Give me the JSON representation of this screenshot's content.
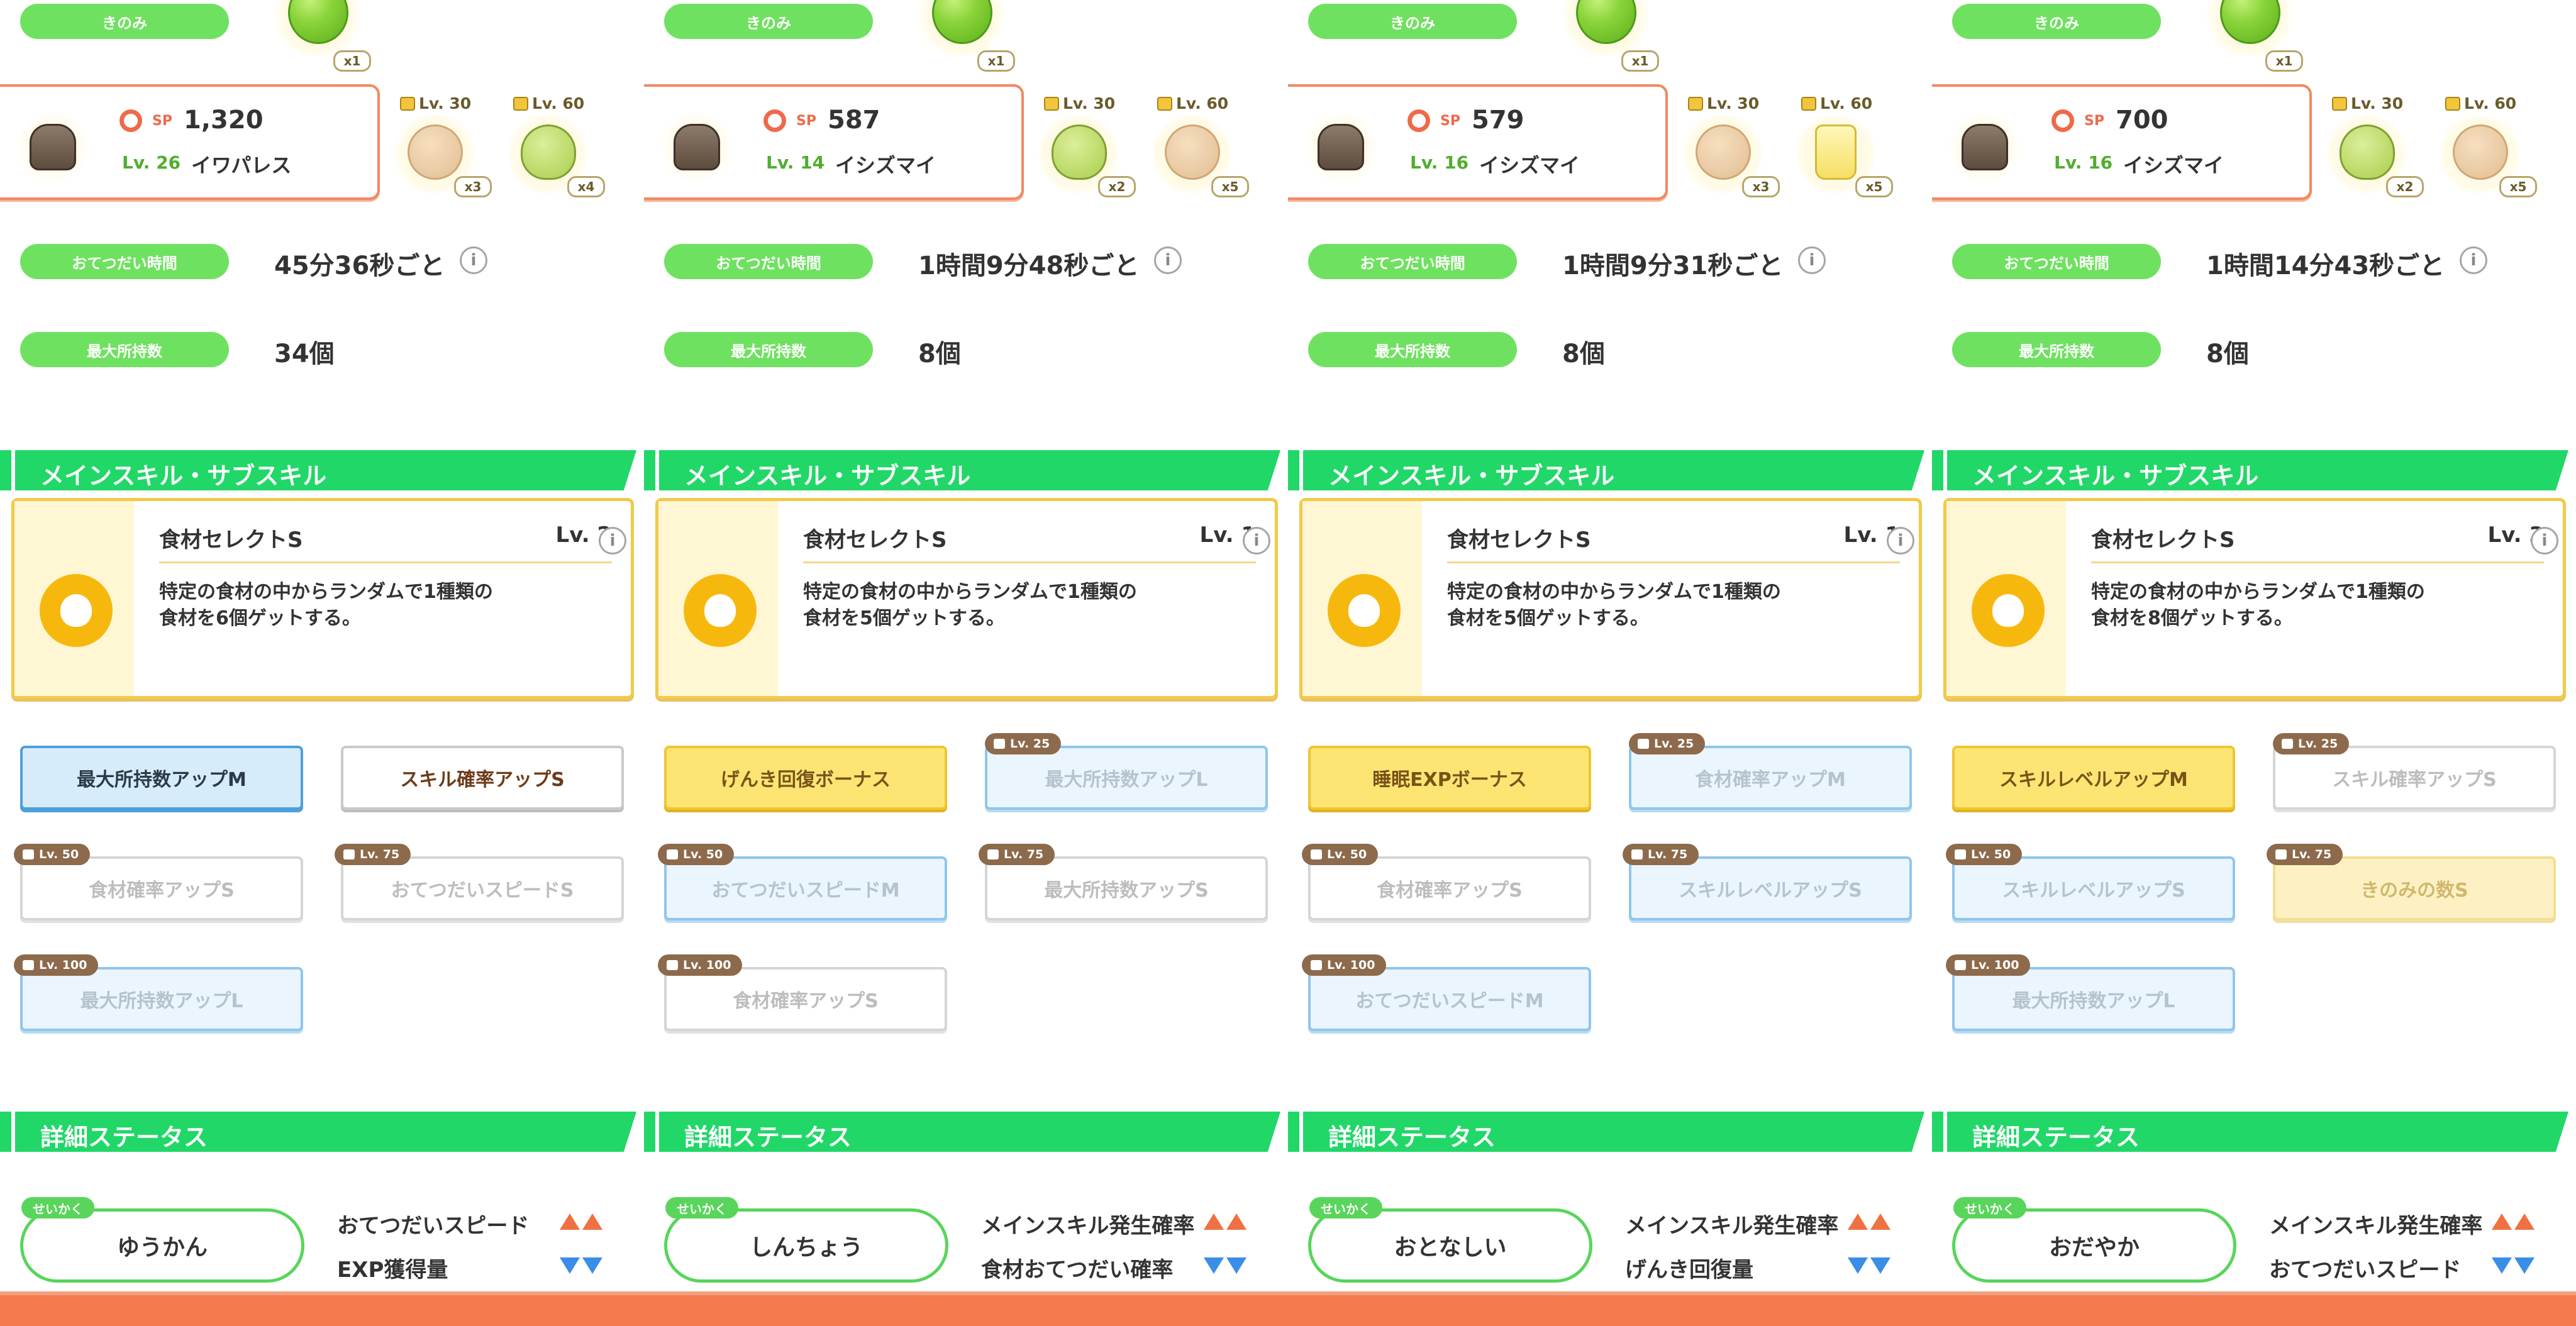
{
  "labels": {
    "berry_pill": "きのみ",
    "help_time_pill": "おてつだい時間",
    "max_inventory_pill": "最大所持数",
    "skills_section": "メインスキル・サブスキル",
    "detail_section": "詳細ステータス",
    "nature_tag": "せいかく",
    "sp_label": "SP",
    "info_glyph": "i",
    "berry_qty": "x1"
  },
  "colors": {
    "green_pill": "#6fe160",
    "section_green": "#21d768",
    "card_border": "#f28860",
    "skill_gold": "#f7b80e",
    "up_arrow": "#ef7040",
    "down_arrow": "#3a8ee6",
    "bottom_bar": "#f57a4f"
  },
  "columns": [
    {
      "sp": "1,320",
      "level": "Lv. 26",
      "name": "イワパレス",
      "ingredients": [
        {
          "lock": "Lv. 30",
          "icon": "potato-icon",
          "shape": "potato",
          "qty": "x3"
        },
        {
          "lock": "Lv. 60",
          "icon": "avocado-icon",
          "shape": "avocado",
          "qty": "x4"
        }
      ],
      "help_time": "45分36秒ごと",
      "max_inventory": "34個",
      "main_skill": {
        "name": "食材セレクトS",
        "level": "Lv. 2",
        "desc1": "特定の食材の中からランダムで1種類の",
        "desc2": "食材を6個ゲットする。"
      },
      "sub_skills": [
        {
          "label": "最大所持数アップM",
          "lock": "",
          "style": "blue active"
        },
        {
          "label": "スキル確率アップS",
          "lock": "",
          "style": "white active"
        },
        {
          "label": "食材確率アップS",
          "lock": "Lv. 50",
          "style": "white"
        },
        {
          "label": "おてつだいスピードS",
          "lock": "Lv. 75",
          "style": "white"
        },
        {
          "label": "最大所持数アップL",
          "lock": "Lv. 100",
          "style": "blue"
        }
      ],
      "nature": "ゆうかん",
      "nature_up": "おてつだいスピード",
      "nature_down": "EXP獲得量"
    },
    {
      "sp": "587",
      "level": "Lv. 14",
      "name": "イシズマイ",
      "ingredients": [
        {
          "lock": "Lv. 30",
          "icon": "avocado-icon",
          "shape": "avocado",
          "qty": "x2"
        },
        {
          "lock": "Lv. 60",
          "icon": "potato-icon",
          "shape": "potato",
          "qty": "x5"
        }
      ],
      "help_time": "1時間9分48秒ごと",
      "max_inventory": "8個",
      "main_skill": {
        "name": "食材セレクトS",
        "level": "Lv. 1",
        "desc1": "特定の食材の中からランダムで1種類の",
        "desc2": "食材を5個ゲットする。"
      },
      "sub_skills": [
        {
          "label": "げんき回復ボーナス",
          "lock": "",
          "style": "gold"
        },
        {
          "label": "最大所持数アップL",
          "lock": "Lv. 25",
          "style": "blue"
        },
        {
          "label": "おてつだいスピードM",
          "lock": "Lv. 50",
          "style": "blue"
        },
        {
          "label": "最大所持数アップS",
          "lock": "Lv. 75",
          "style": "white"
        },
        {
          "label": "食材確率アップS",
          "lock": "Lv. 100",
          "style": "white"
        }
      ],
      "nature": "しんちょう",
      "nature_up": "メインスキル発生確率",
      "nature_down": "食材おてつだい確率"
    },
    {
      "sp": "579",
      "level": "Lv. 16",
      "name": "イシズマイ",
      "ingredients": [
        {
          "lock": "Lv. 30",
          "icon": "potato-icon",
          "shape": "potato",
          "qty": "x3"
        },
        {
          "lock": "Lv. 60",
          "icon": "oil-bottle-icon",
          "shape": "oil",
          "qty": "x5"
        }
      ],
      "help_time": "1時間9分31秒ごと",
      "max_inventory": "8個",
      "main_skill": {
        "name": "食材セレクトS",
        "level": "Lv. 1",
        "desc1": "特定の食材の中からランダムで1種類の",
        "desc2": "食材を5個ゲットする。"
      },
      "sub_skills": [
        {
          "label": "睡眠EXPボーナス",
          "lock": "",
          "style": "gold"
        },
        {
          "label": "食材確率アップM",
          "lock": "Lv. 25",
          "style": "blue"
        },
        {
          "label": "食材確率アップS",
          "lock": "Lv. 50",
          "style": "white"
        },
        {
          "label": "スキルレベルアップS",
          "lock": "Lv. 75",
          "style": "blue"
        },
        {
          "label": "おてつだいスピードM",
          "lock": "Lv. 100",
          "style": "blue"
        }
      ],
      "nature": "おとなしい",
      "nature_up": "メインスキル発生確率",
      "nature_down": "げんき回復量"
    },
    {
      "sp": "700",
      "level": "Lv. 16",
      "name": "イシズマイ",
      "ingredients": [
        {
          "lock": "Lv. 30",
          "icon": "avocado-icon",
          "shape": "avocado",
          "qty": "x2"
        },
        {
          "lock": "Lv. 60",
          "icon": "potato-icon",
          "shape": "potato",
          "qty": "x5"
        }
      ],
      "help_time": "1時間14分43秒ごと",
      "max_inventory": "8個",
      "main_skill": {
        "name": "食材セレクトS",
        "level": "Lv. 3",
        "desc1": "特定の食材の中からランダムで1種類の",
        "desc2": "食材を8個ゲットする。"
      },
      "sub_skills": [
        {
          "label": "スキルレベルアップM",
          "lock": "",
          "style": "gold"
        },
        {
          "label": "スキル確率アップS",
          "lock": "Lv. 25",
          "style": "white"
        },
        {
          "label": "スキルレベルアップS",
          "lock": "Lv. 50",
          "style": "blue"
        },
        {
          "label": "きのみの数S",
          "lock": "Lv. 75",
          "style": "gold locked"
        },
        {
          "label": "最大所持数アップL",
          "lock": "Lv. 100",
          "style": "blue"
        }
      ],
      "nature": "おだやか",
      "nature_up": "メインスキル発生確率",
      "nature_down": "おてつだいスピード"
    }
  ]
}
